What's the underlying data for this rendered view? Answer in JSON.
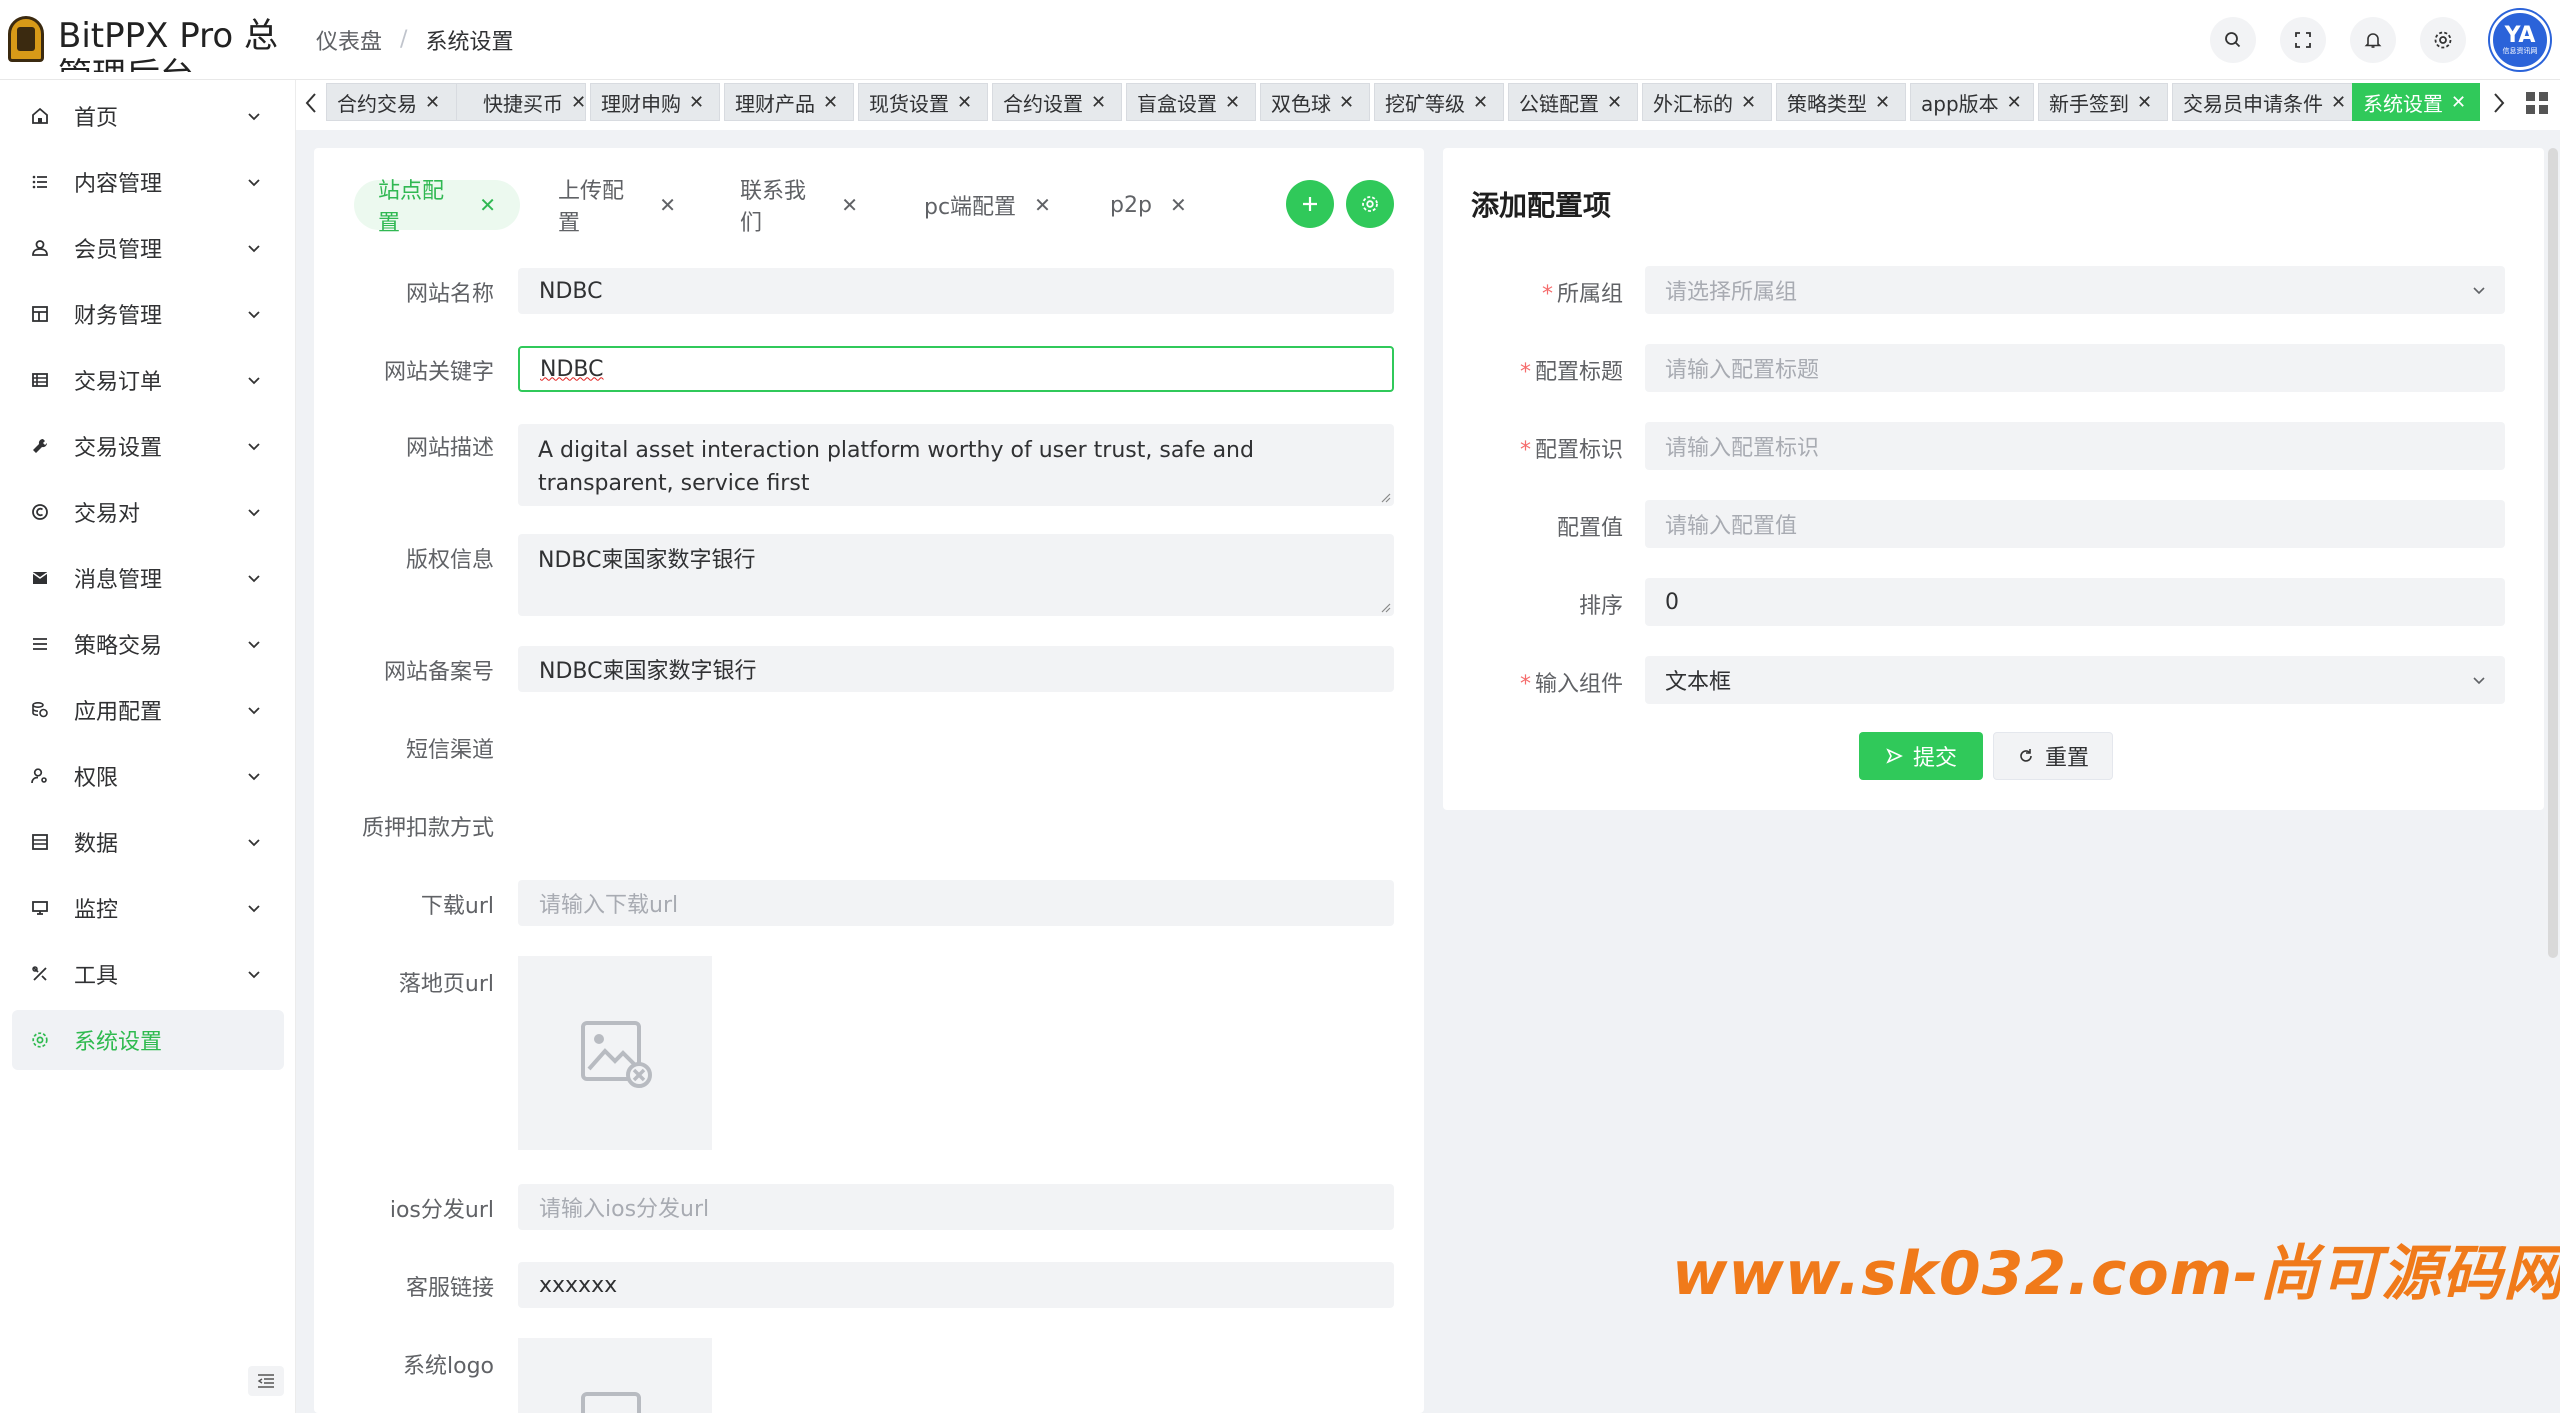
{
  "app": {
    "title": "BitPPX Pro 总管理后台"
  },
  "breadcrumb": {
    "home": "仪表盘",
    "separator": "/",
    "current": "系统设置"
  },
  "header": {
    "avatar_text": "YA",
    "avatar_sub": "信息资讯网"
  },
  "sidebar": {
    "items": [
      {
        "label": "首页",
        "icon": "home-icon"
      },
      {
        "label": "内容管理",
        "icon": "list-icon"
      },
      {
        "label": "会员管理",
        "icon": "user-icon"
      },
      {
        "label": "财务管理",
        "icon": "grid-icon"
      },
      {
        "label": "交易订单",
        "icon": "table-icon"
      },
      {
        "label": "交易设置",
        "icon": "wrench-icon"
      },
      {
        "label": "交易对",
        "icon": "copyright-icon"
      },
      {
        "label": "消息管理",
        "icon": "message-icon"
      },
      {
        "label": "策略交易",
        "icon": "menu-icon"
      },
      {
        "label": "应用配置",
        "icon": "coins-icon"
      },
      {
        "label": "权限",
        "icon": "user-key-icon"
      },
      {
        "label": "数据",
        "icon": "data-icon"
      },
      {
        "label": "监控",
        "icon": "monitor-icon"
      },
      {
        "label": "工具",
        "icon": "tools-icon"
      },
      {
        "label": "系统设置",
        "icon": "gear-icon"
      }
    ]
  },
  "tags": [
    {
      "label": "合约交易"
    },
    {
      "label": "快捷买币"
    },
    {
      "label": "理财申购"
    },
    {
      "label": "理财产品"
    },
    {
      "label": "现货设置"
    },
    {
      "label": "合约设置"
    },
    {
      "label": "盲盒设置"
    },
    {
      "label": "双色球"
    },
    {
      "label": "挖矿等级"
    },
    {
      "label": "公链配置"
    },
    {
      "label": "外汇标的"
    },
    {
      "label": "策略类型"
    },
    {
      "label": "app版本"
    },
    {
      "label": "新手签到"
    },
    {
      "label": "交易员申请条件"
    },
    {
      "label": "系统设置"
    }
  ],
  "config_tabs": [
    "站点配置",
    "上传配置",
    "联系我们",
    "pc端配置",
    "p2p"
  ],
  "form": {
    "site_name": {
      "label": "网站名称",
      "value": "NDBC"
    },
    "site_keywords": {
      "label": "网站关键字",
      "value": "NDBC"
    },
    "site_desc": {
      "label": "网站描述",
      "value": "A digital asset interaction platform worthy of user trust, safe and transparent, service first"
    },
    "copyright": {
      "label": "版权信息",
      "value": "NDBC柬国家数字银行"
    },
    "icp": {
      "label": "网站备案号",
      "value": "NDBC柬国家数字银行"
    },
    "sms": {
      "label": "短信渠道"
    },
    "pledge": {
      "label": "质押扣款方式"
    },
    "download_url": {
      "label": "下载url",
      "placeholder": "请输入下载url"
    },
    "landing_url": {
      "label": "落地页url"
    },
    "ios_url": {
      "label": "ios分发url",
      "placeholder": "请输入ios分发url"
    },
    "service_link": {
      "label": "客服链接",
      "value": "xxxxxx"
    },
    "logo": {
      "label": "系统logo"
    }
  },
  "add_config": {
    "title": "添加配置项",
    "group": {
      "label": "所属组",
      "placeholder": "请选择所属组"
    },
    "cfg_title": {
      "label": "配置标题",
      "placeholder": "请输入配置标题"
    },
    "cfg_key": {
      "label": "配置标识",
      "placeholder": "请输入配置标识"
    },
    "cfg_value": {
      "label": "配置值",
      "placeholder": "请输入配置值"
    },
    "sort": {
      "label": "排序",
      "value": "0"
    },
    "component": {
      "label": "输入组件",
      "value": "文本框"
    },
    "submit": "提交",
    "reset": "重置"
  },
  "watermark": "www.sk032.com-尚可源码网",
  "colors": {
    "accent": "#30c95a",
    "required": "#f56c6c",
    "watermark": "#f07a1a"
  }
}
